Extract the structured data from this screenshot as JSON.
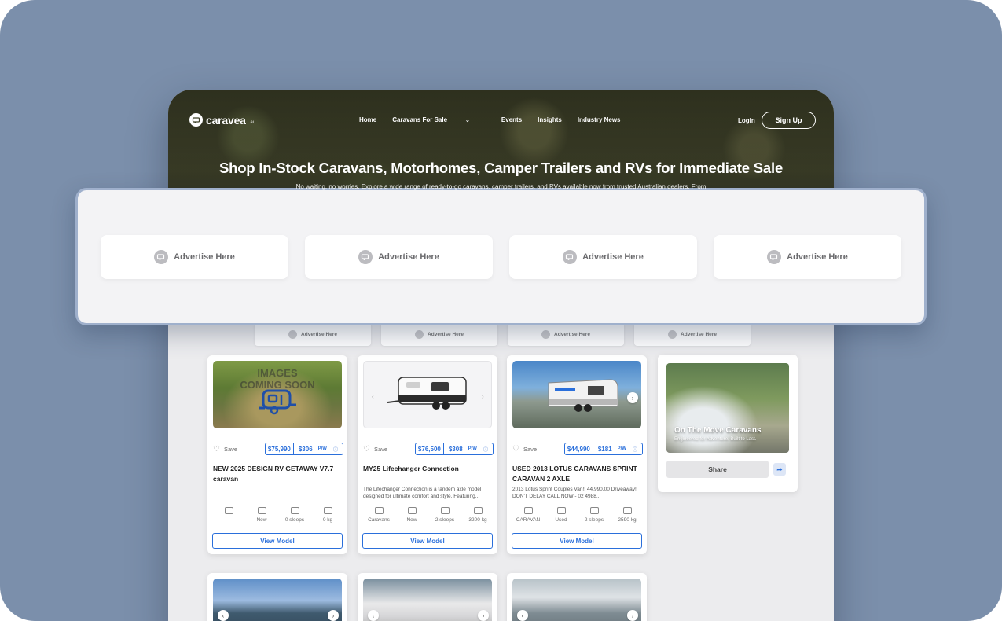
{
  "brand": {
    "name": "caravea",
    "suffix": ".au"
  },
  "nav": {
    "links": [
      "Home",
      "Caravans For Sale",
      "Events",
      "Insights",
      "Industry News"
    ],
    "login": "Login",
    "signup": "Sign Up"
  },
  "hero": {
    "title": "Shop In-Stock Caravans, Motorhomes, Camper Trailers and RVs for Immediate Sale",
    "subtitle": "No waiting, no worries. Explore a wide range of ready-to-go caravans, camper trailers, and RVs available now from trusted Australian dealers. From"
  },
  "overlay_ads": [
    "Advertise Here",
    "Advertise Here",
    "Advertise Here",
    "Advertise Here"
  ],
  "small_ads": [
    "Advertise Here",
    "Advertise Here",
    "Advertise Here",
    "Advertise Here"
  ],
  "cards": [
    {
      "image_text": [
        "IMAGES",
        "COMING SOON"
      ],
      "save": "Save",
      "price": "$75,990",
      "weekly": "$306",
      "per": "P/W",
      "title": "NEW 2025 DESIGN RV GETAWAY V7.7 caravan",
      "desc": "",
      "specs": [
        "-",
        "New",
        "0 sleeps",
        "0 kg"
      ],
      "button": "View Model"
    },
    {
      "save": "Save",
      "price": "$76,500",
      "weekly": "$308",
      "per": "P/W",
      "title": "MY25 Lifechanger Connection",
      "desc": "The Lifechanger Connection is a tandem axle model designed for ultimate comfort and style. Featuring...",
      "specs": [
        "Caravans",
        "New",
        "2 sleeps",
        "3200 kg"
      ],
      "button": "View Model"
    },
    {
      "save": "Save",
      "price": "$44,990",
      "weekly": "$181",
      "per": "P/W",
      "title": "USED 2013 LOTUS CARAVANS SPRINT CARAVAN 2 AXLE",
      "desc": "2013 Lotus Sprint Couples Van!! 44,990.00 Driveaway! DON'T DELAY CALL NOW - 02 4988...",
      "specs": [
        "CARAVAN",
        "Used",
        "2 sleeps",
        "2590 kg"
      ],
      "button": "View Model"
    }
  ],
  "side_ad": {
    "title": "On The Move Caravans",
    "subtitle": "Engineered for Adventure. Built to Last.",
    "share": "Share"
  },
  "colors": {
    "accent": "#2a6fdb",
    "backdrop": "#7b8fab",
    "overlay_border": "#9fb0cc"
  }
}
